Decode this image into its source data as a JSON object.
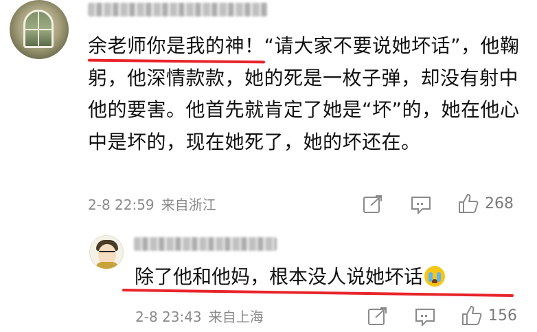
{
  "comment": {
    "text_line1_underlined": "余老师你是我的神！",
    "text_rest": "“请大家不要说她坏话”，他鞠躬，他深情款款，她的死是一枚子弹，却没有射中他的要害。他首先就肯定了她是“坏”的，她在他心中是坏的，现在她死了，她的坏还在。",
    "time": "2-8 22:59",
    "location": "来自浙江",
    "likes": "268",
    "icons": [
      "share-icon",
      "comment-icon",
      "like-icon"
    ]
  },
  "reply": {
    "text": "除了他和他妈，根本没人说她坏话",
    "emoji": "crying-face-emoji",
    "time": "2-8 23:43",
    "location": "来自上海",
    "likes": "156",
    "icons": [
      "share-icon",
      "comment-icon",
      "like-icon"
    ]
  },
  "colors": {
    "underline": "#e8242b",
    "meta_text": "#8a8a8a",
    "body_text": "#111111"
  }
}
